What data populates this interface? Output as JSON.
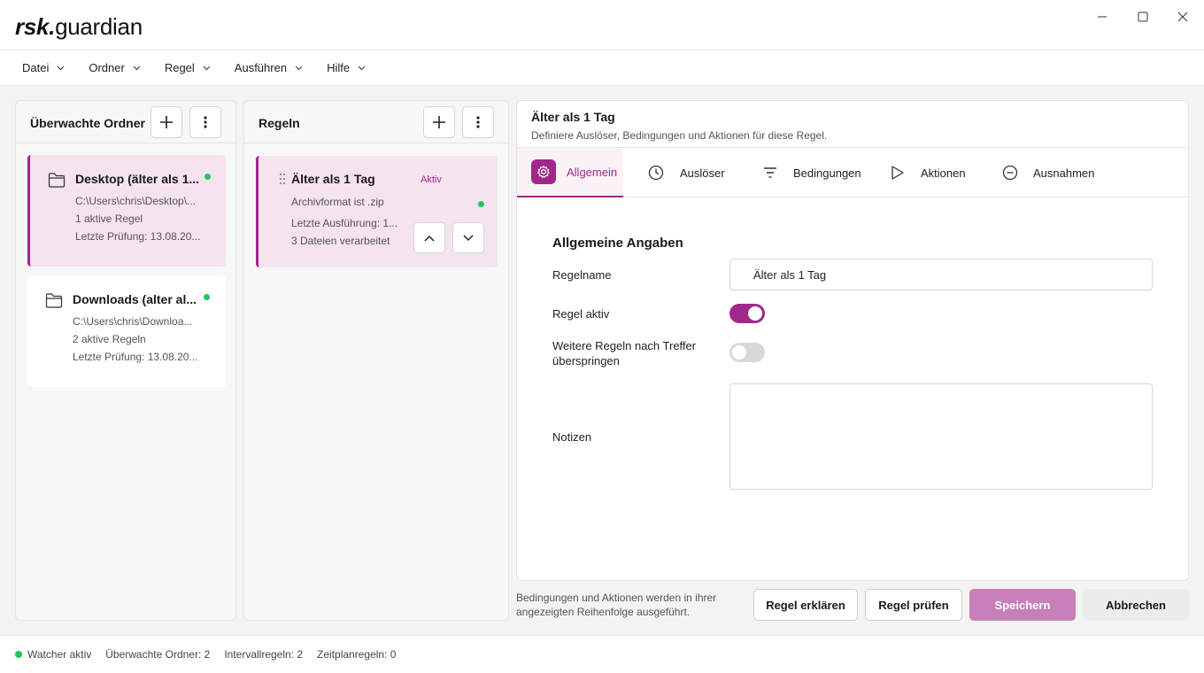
{
  "app": {
    "logo_bold": "rsk.",
    "logo_regular": "guardian"
  },
  "menu": [
    "Datei",
    "Ordner",
    "Regel",
    "Ausführen",
    "Hilfe"
  ],
  "folders_panel": {
    "title": "Überwachte Ordner",
    "items": [
      {
        "name": "Desktop (älter als 1...",
        "path": "C:\\Users\\chris\\Desktop\\...",
        "rules": "1 aktive Regel",
        "last_check": "Letzte Prüfung: 13.08.20...",
        "selected": true,
        "status_color": "#22c55e"
      },
      {
        "name": "Downloads (alter al...",
        "path": "C:\\Users\\chris\\Downloa...",
        "rules": "2 aktive Regeln",
        "last_check": "Letzte Prüfung: 13.08.20...",
        "selected": false,
        "status_color": "#22c55e"
      }
    ]
  },
  "rules_panel": {
    "title": "Regeln",
    "items": [
      {
        "name": "Älter als 1 Tag",
        "badge": "Aktiv",
        "condition": "Archivformat ist .zip",
        "last_run": "Letzte Ausführung: 1...",
        "processed": "3 Dateien verarbeitet",
        "status_color": "#22c55e"
      }
    ]
  },
  "detail": {
    "title": "Älter als 1 Tag",
    "subtitle": "Definiere Auslöser, Bedingungen und Aktionen für diese Regel.",
    "tabs": [
      {
        "label": "Allgemein",
        "icon": "gear-icon",
        "active": true
      },
      {
        "label": "Auslöser",
        "icon": "clock-icon",
        "active": false
      },
      {
        "label": "Bedingungen",
        "icon": "filter-icon",
        "active": false
      },
      {
        "label": "Aktionen",
        "icon": "play-icon",
        "active": false
      },
      {
        "label": "Ausnahmen",
        "icon": "minus-circle-icon",
        "active": false
      }
    ],
    "section_title": "Allgemeine Angaben",
    "fields": {
      "name_label": "Regelname",
      "name_value": "Älter als 1 Tag",
      "active_label": "Regel aktiv",
      "active_on": true,
      "skip_label_1": "Weitere Regeln nach Treffer",
      "skip_label_2": "überspringen",
      "skip_on": false,
      "notes_label": "Notizen",
      "notes_value": ""
    }
  },
  "footer": {
    "note_1": "Bedingungen und Aktionen werden in ihrer",
    "note_2": "angezeigten Reihenfolge ausgeführt.",
    "explain": "Regel erklären",
    "check": "Regel prüfen",
    "save": "Speichern",
    "cancel": "Abbrechen"
  },
  "status": {
    "watcher": "Watcher aktiv",
    "folders": "Überwachte Ordner: 2",
    "interval": "Intervallregeln: 2",
    "schedule": "Zeitplanregeln: 0"
  },
  "colors": {
    "accent": "#a0288a",
    "accent_light": "#f5e3f0",
    "status_ok": "#22c55e"
  }
}
